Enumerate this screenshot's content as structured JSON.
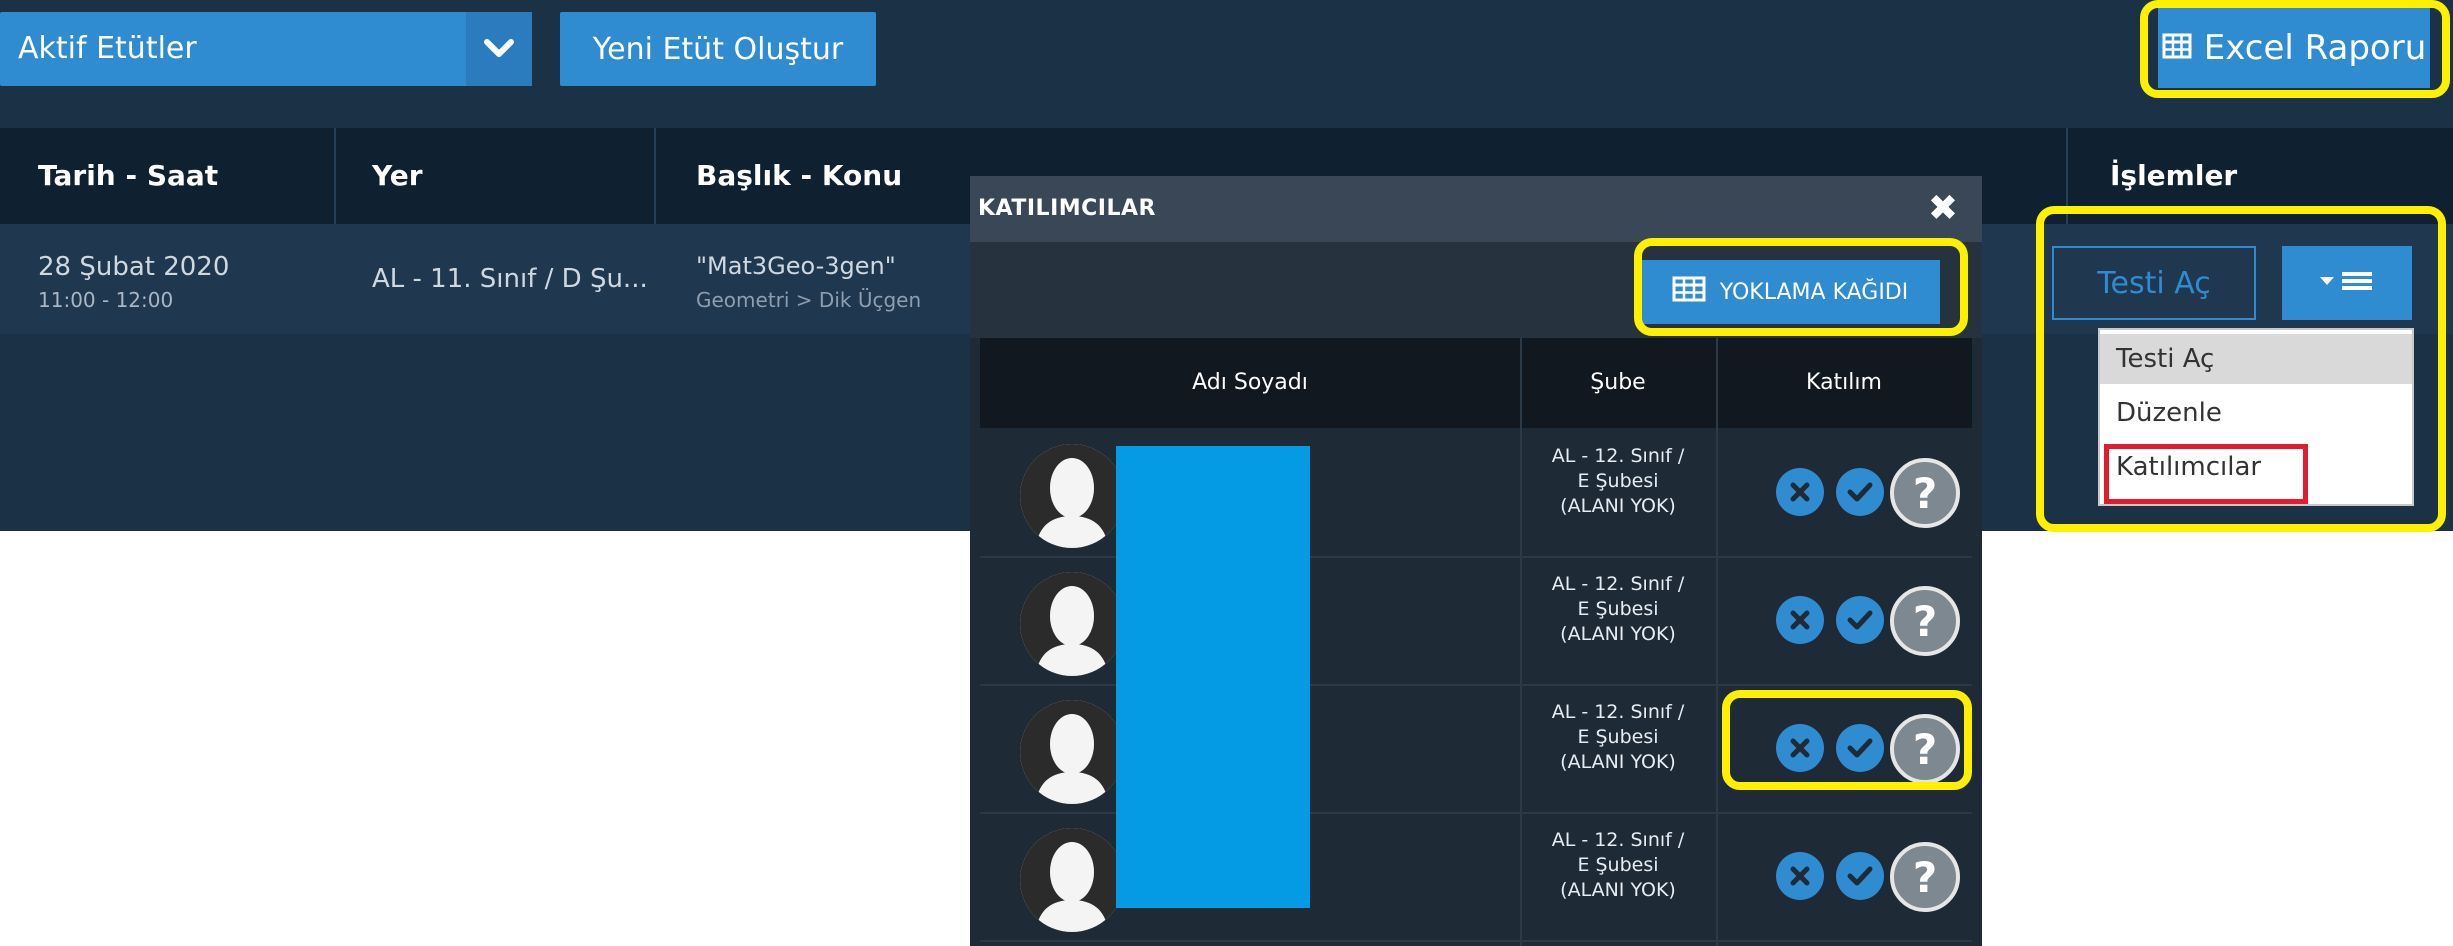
{
  "toolbar": {
    "select_value": "Aktif Etütler",
    "new_button_label": "Yeni Etüt Oluştur",
    "excel_button_label": "Excel Raporu"
  },
  "table": {
    "headers": [
      "Tarih - Saat",
      "Yer",
      "Başlık - Konu",
      "İşlemler"
    ],
    "row": {
      "date": "28 Şubat 2020",
      "time": "11:00 - 12:00",
      "place": "AL - 11. Sınıf / D Şu...",
      "title": "\"Mat3Geo-3gen\"",
      "topic": "Geometri > Dik Üçgen"
    }
  },
  "modal": {
    "title": "KATILIMCILAR",
    "close_glyph": "✖",
    "attendance_button_label": "YOKLAMA KAĞIDI",
    "headers": {
      "name": "Adı Soyadı",
      "branch": "Şube",
      "participation": "Katılım"
    },
    "rows": [
      {
        "branch_line1": "AL - 12. Sınıf /",
        "branch_line2": "E Şubesi",
        "branch_line3": "(ALANI YOK)"
      },
      {
        "branch_line1": "AL - 12. Sınıf /",
        "branch_line2": "E Şubesi",
        "branch_line3": "(ALANI YOK)"
      },
      {
        "branch_line1": "AL - 12. Sınıf /",
        "branch_line2": "E Şubesi",
        "branch_line3": "(ALANI YOK)"
      },
      {
        "branch_line1": "AL - 12. Sınıf /",
        "branch_line2": "E Şubesi",
        "branch_line3": "(ALANI YOK)"
      }
    ]
  },
  "actions": {
    "open_test_label": "Testi Aç",
    "menu_items": [
      "Testi Aç",
      "Düzenle",
      "Katılımcılar"
    ]
  },
  "colors": {
    "accent": "#2f8cd0",
    "highlight": "#fff000",
    "red_box": "#e01d2e",
    "redaction": "#049be4"
  },
  "icons": {
    "select_chevron": "chevron-down-icon",
    "excel": "table-icon",
    "attendance": "table-icon",
    "reject": "x-circle-icon",
    "accept": "check-circle-icon",
    "unknown": "question-circle-icon",
    "menu": "caret-bars-icon"
  }
}
